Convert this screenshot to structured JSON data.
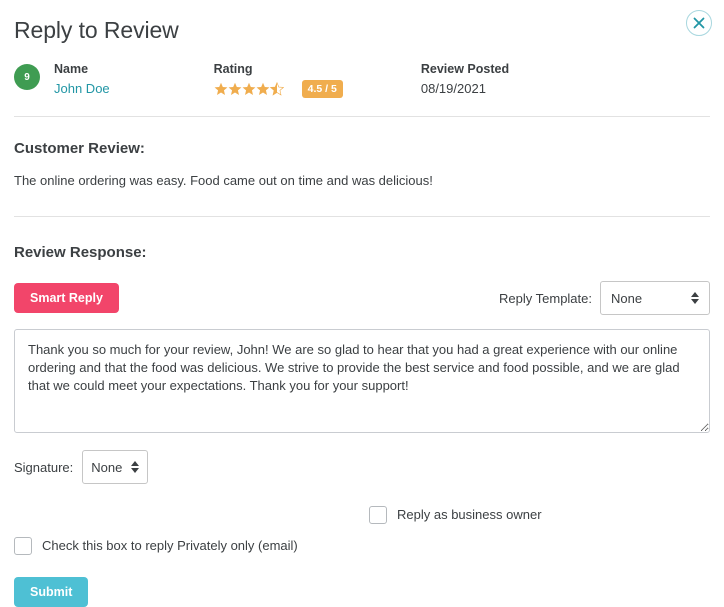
{
  "header": {
    "title": "Reply to Review",
    "close_icon": "close-icon"
  },
  "meta": {
    "avatar_initial": "9",
    "name_label": "Name",
    "name_value": "John Doe",
    "rating_label": "Rating",
    "rating_value": 4.5,
    "rating_max": 5,
    "rating_badge": "4.5 / 5",
    "posted_label": "Review Posted",
    "posted_value": "08/19/2021"
  },
  "customer_review": {
    "heading": "Customer Review:",
    "text": "The online ordering was easy. Food came out on time and was delicious!"
  },
  "review_response": {
    "heading": "Review Response:",
    "smart_reply_label": "Smart Reply",
    "template_label": "Reply Template:",
    "template_value": "None",
    "reply_text": "Thank you so much for your review, John! We are so glad to hear that you had a great experience with our online ordering and that the food was delicious. We strive to provide the best service and food possible, and we are glad that we could meet your expectations. Thank you for your support!",
    "reply_placeholder": "",
    "signature_label": "Signature:",
    "signature_value": "None",
    "checkbox_owner_label": "Reply as business owner",
    "checkbox_owner_checked": false,
    "checkbox_private_label": "Check this box to reply Privately only (email)",
    "checkbox_private_checked": false,
    "submit_label": "Submit"
  },
  "colors": {
    "accent_teal": "#4ec0d4",
    "smart_reply_pink": "#f2456a",
    "avatar_green": "#3f9c52",
    "star_orange": "#f0ad4e",
    "link_teal": "#2196a5"
  }
}
